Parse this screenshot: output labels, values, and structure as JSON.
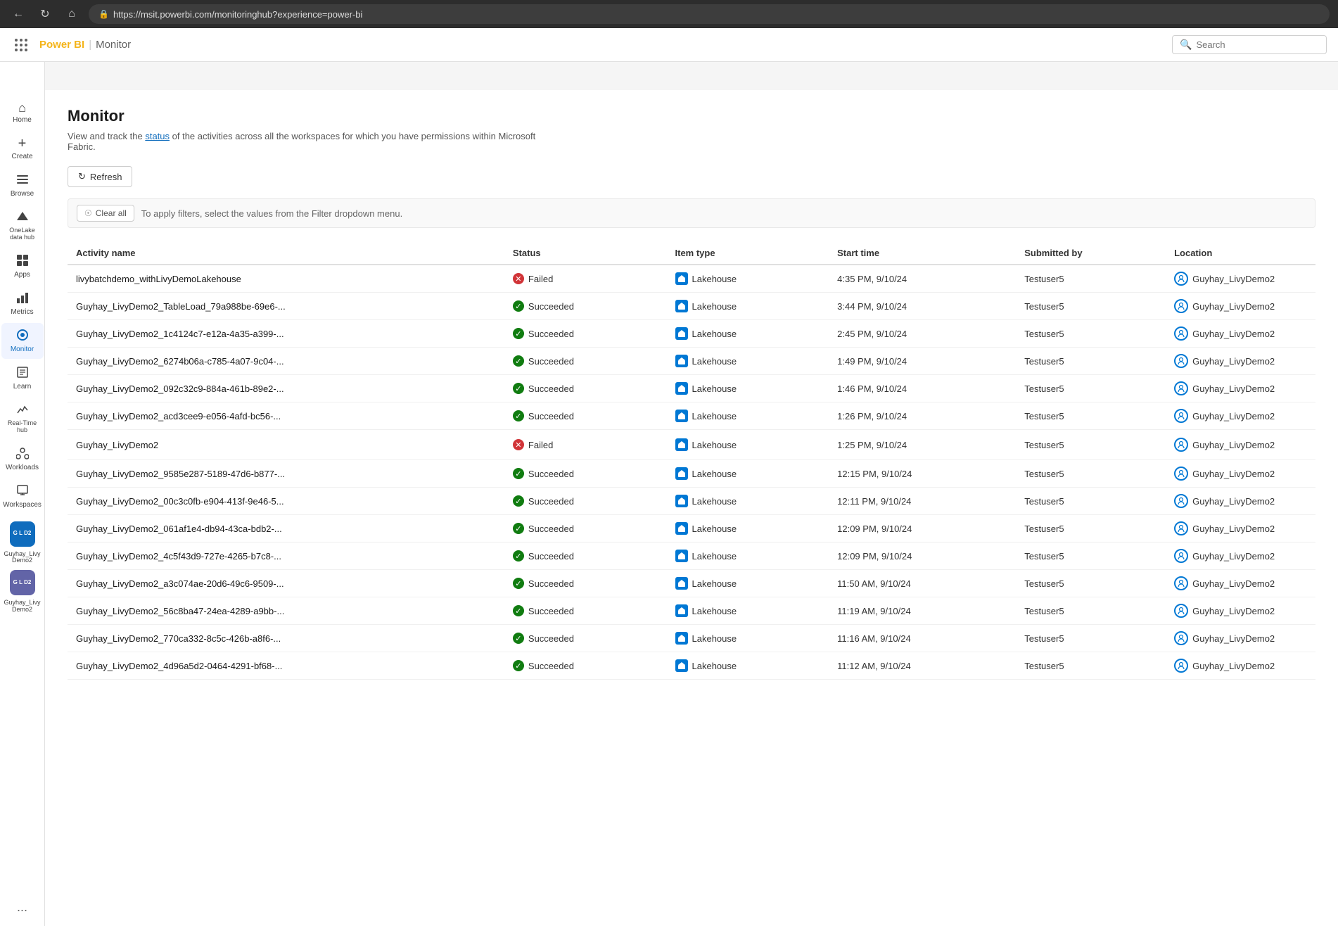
{
  "browser": {
    "url": "https://msit.powerbi.com/monitoringhub?experience=power-bi",
    "back_label": "←",
    "refresh_label": "↻",
    "home_label": "⌂"
  },
  "topbar": {
    "waffle_label": "Apps",
    "brand": "Power BI",
    "section": "Monitor",
    "search_placeholder": "Search"
  },
  "sidebar": {
    "items": [
      {
        "id": "home",
        "icon": "⌂",
        "label": "Home"
      },
      {
        "id": "create",
        "icon": "+",
        "label": "Create"
      },
      {
        "id": "browse",
        "icon": "☰",
        "label": "Browse"
      },
      {
        "id": "onelake",
        "icon": "◈",
        "label": "OneLake data hub"
      },
      {
        "id": "apps",
        "icon": "⊞",
        "label": "Apps"
      },
      {
        "id": "metrics",
        "icon": "📊",
        "label": "Metrics"
      },
      {
        "id": "monitor",
        "icon": "●",
        "label": "Monitor"
      },
      {
        "id": "learn",
        "icon": "📖",
        "label": "Learn"
      },
      {
        "id": "realtime",
        "icon": "⚡",
        "label": "Real-Time hub"
      },
      {
        "id": "workloads",
        "icon": "🔧",
        "label": "Workloads"
      },
      {
        "id": "workspaces",
        "icon": "📁",
        "label": "Workspaces"
      }
    ],
    "workspace1_label": "Guyhay_Livy Demo2",
    "workspace2_label": "Guyhay_Livy Demo2",
    "more_label": "..."
  },
  "page": {
    "title": "Monitor",
    "subtitle": "View and track the status of the activities across all the workspaces for which you have permissions within Microsoft Fabric.",
    "subtitle_link_text": "status"
  },
  "toolbar": {
    "refresh_label": "Refresh",
    "clear_all_label": "Clear all",
    "filter_hint": "To apply filters, select the values from the Filter dropdown menu."
  },
  "table": {
    "columns": [
      "Activity name",
      "Status",
      "Item type",
      "Start time",
      "Submitted by",
      "Location"
    ],
    "rows": [
      {
        "activity": "livybatchdemo_withLivyDemoLakehouse",
        "status": "Failed",
        "status_type": "failed",
        "item_type": "Lakehouse",
        "start_time": "4:35 PM, 9/10/24",
        "submitted_by": "Testuser5",
        "location": "Guyhay_LivyDemo2",
        "has_actions": false
      },
      {
        "activity": "Guyhay_LivyDemo2_TableLoad_79a988be-69e6-...",
        "status": "Succeeded",
        "status_type": "succeeded",
        "item_type": "Lakehouse",
        "start_time": "3:44 PM, 9/10/24",
        "submitted_by": "Testuser5",
        "location": "Guyhay_LivyDemo2",
        "has_actions": false
      },
      {
        "activity": "Guyhay_LivyDemo2_1c4124c7-e12a-4a35-a399-...",
        "status": "Succeeded",
        "status_type": "succeeded",
        "item_type": "Lakehouse",
        "start_time": "2:45 PM, 9/10/24",
        "submitted_by": "Testuser5",
        "location": "Guyhay_LivyDemo2",
        "has_actions": false
      },
      {
        "activity": "Guyhay_LivyDemo2_6274b06a-c785-4a07-9c04-...",
        "status": "Succeeded",
        "status_type": "succeeded",
        "item_type": "Lakehouse",
        "start_time": "1:49 PM, 9/10/24",
        "submitted_by": "Testuser5",
        "location": "Guyhay_LivyDemo2",
        "has_actions": false
      },
      {
        "activity": "Guyhay_LivyDemo2_092c32c9-884a-461b-89e2-...",
        "status": "Succeeded",
        "status_type": "succeeded",
        "item_type": "Lakehouse",
        "start_time": "1:46 PM, 9/10/24",
        "submitted_by": "Testuser5",
        "location": "Guyhay_LivyDemo2",
        "has_actions": false
      },
      {
        "activity": "Guyhay_LivyDemo2_acd3cee9-e056-4afd-bc56-...",
        "status": "Succeeded",
        "status_type": "succeeded",
        "item_type": "Lakehouse",
        "start_time": "1:26 PM, 9/10/24",
        "submitted_by": "Testuser5",
        "location": "Guyhay_LivyDemo2",
        "has_actions": false
      },
      {
        "activity": "Guyhay_LivyDemo2",
        "status": "Failed",
        "status_type": "failed",
        "item_type": "Lakehouse",
        "start_time": "1:25 PM, 9/10/24",
        "submitted_by": "Testuser5",
        "location": "Guyhay_LivyDemo2",
        "has_actions": true
      },
      {
        "activity": "Guyhay_LivyDemo2_9585e287-5189-47d6-b877-...",
        "status": "Succeeded",
        "status_type": "succeeded",
        "item_type": "Lakehouse",
        "start_time": "12:15 PM, 9/10/24",
        "submitted_by": "Testuser5",
        "location": "Guyhay_LivyDemo2",
        "has_actions": false
      },
      {
        "activity": "Guyhay_LivyDemo2_00c3c0fb-e904-413f-9e46-5...",
        "status": "Succeeded",
        "status_type": "succeeded",
        "item_type": "Lakehouse",
        "start_time": "12:11 PM, 9/10/24",
        "submitted_by": "Testuser5",
        "location": "Guyhay_LivyDemo2",
        "has_actions": false
      },
      {
        "activity": "Guyhay_LivyDemo2_061af1e4-db94-43ca-bdb2-...",
        "status": "Succeeded",
        "status_type": "succeeded",
        "item_type": "Lakehouse",
        "start_time": "12:09 PM, 9/10/24",
        "submitted_by": "Testuser5",
        "location": "Guyhay_LivyDemo2",
        "has_actions": false
      },
      {
        "activity": "Guyhay_LivyDemo2_4c5f43d9-727e-4265-b7c8-...",
        "status": "Succeeded",
        "status_type": "succeeded",
        "item_type": "Lakehouse",
        "start_time": "12:09 PM, 9/10/24",
        "submitted_by": "Testuser5",
        "location": "Guyhay_LivyDemo2",
        "has_actions": false
      },
      {
        "activity": "Guyhay_LivyDemo2_a3c074ae-20d6-49c6-9509-...",
        "status": "Succeeded",
        "status_type": "succeeded",
        "item_type": "Lakehouse",
        "start_time": "11:50 AM, 9/10/24",
        "submitted_by": "Testuser5",
        "location": "Guyhay_LivyDemo2",
        "has_actions": false
      },
      {
        "activity": "Guyhay_LivyDemo2_56c8ba47-24ea-4289-a9bb-...",
        "status": "Succeeded",
        "status_type": "succeeded",
        "item_type": "Lakehouse",
        "start_time": "11:19 AM, 9/10/24",
        "submitted_by": "Testuser5",
        "location": "Guyhay_LivyDemo2",
        "has_actions": false
      },
      {
        "activity": "Guyhay_LivyDemo2_770ca332-8c5c-426b-a8f6-...",
        "status": "Succeeded",
        "status_type": "succeeded",
        "item_type": "Lakehouse",
        "start_time": "11:16 AM, 9/10/24",
        "submitted_by": "Testuser5",
        "location": "Guyhay_LivyDemo2",
        "has_actions": false
      },
      {
        "activity": "Guyhay_LivyDemo2_4d96a5d2-0464-4291-bf68-...",
        "status": "Succeeded",
        "status_type": "succeeded",
        "item_type": "Lakehouse",
        "start_time": "11:12 AM, 9/10/24",
        "submitted_by": "Testuser5",
        "location": "Guyhay_LivyDemo2",
        "has_actions": false
      }
    ]
  },
  "colors": {
    "brand_yellow": "#f4b41a",
    "brand_blue": "#0f6cbd",
    "success_green": "#107c10",
    "fail_red": "#d13438"
  }
}
